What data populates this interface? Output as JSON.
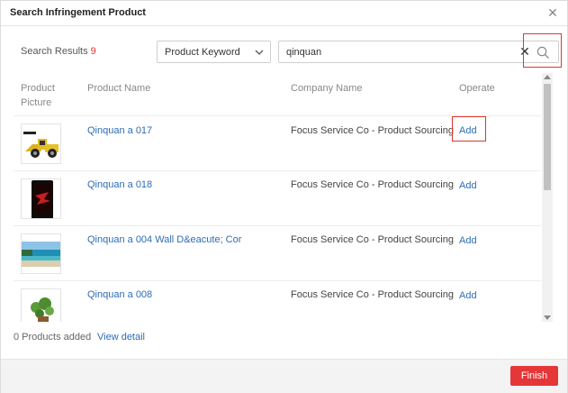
{
  "dialog": {
    "title": "Search Infringement Product",
    "close_icon": "close-icon"
  },
  "search": {
    "results_label": "Search Results",
    "results_count": "9",
    "type_select": "Product Keyword",
    "query": "qinquan"
  },
  "table": {
    "headers": {
      "picture_line1": "Product",
      "picture_line2": "Picture",
      "name": "Product Name",
      "company": "Company Name",
      "operate": "Operate"
    },
    "rows": [
      {
        "name": "Qinquan a 017",
        "company": "Focus Service Co - Product Sourcing",
        "action": "Add",
        "thumb": "wheel-loader-image"
      },
      {
        "name": "Qinquan a 018",
        "company": "Focus Service Co - Product Sourcing",
        "action": "Add",
        "thumb": "phone-image"
      },
      {
        "name": "Qinquan a 004 Wall D&eacute; Cor",
        "company": "Focus Service Co - Product Sourcing",
        "action": "Add",
        "thumb": "beach-image"
      },
      {
        "name": "Qinquan a 008",
        "company": "Focus Service Co - Product Sourcing",
        "action": "Add",
        "thumb": "plant-image"
      }
    ]
  },
  "footer": {
    "added_text": "0 Products added",
    "view_detail": "View detail",
    "finish": "Finish"
  },
  "colors": {
    "accent_red": "#e53638",
    "link_blue": "#2d6db5",
    "count_red": "#e0352b"
  }
}
